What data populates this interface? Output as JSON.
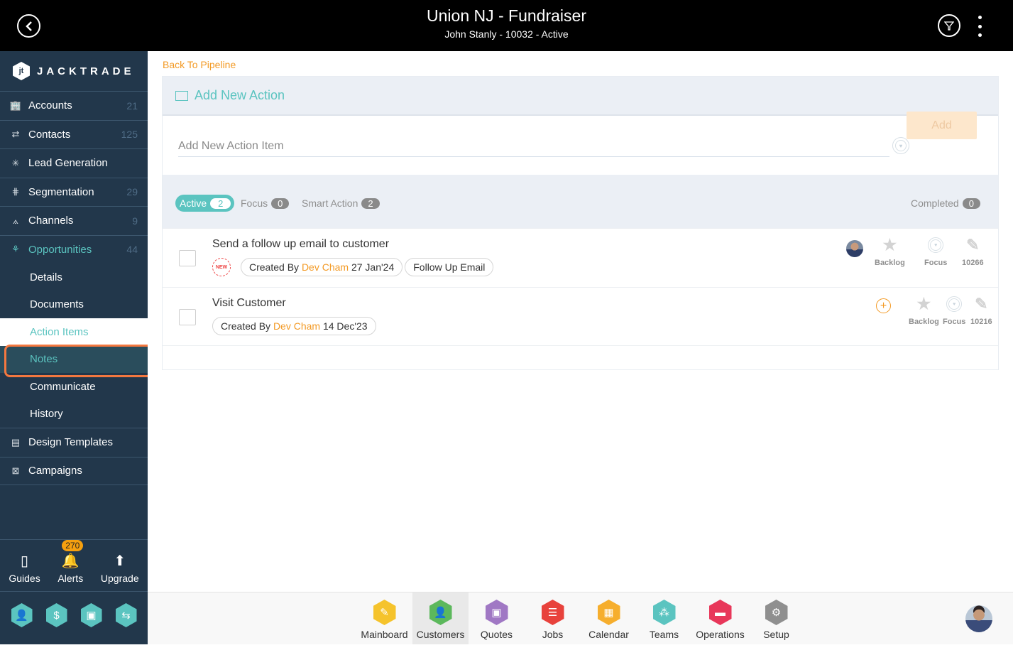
{
  "header": {
    "title": "Union NJ - Fundraiser",
    "subtitle": "John Stanly - 10032 - Active",
    "back_icon": "circle-chevron-left-icon",
    "filter_icon": "filter-icon",
    "menu_icon": "kebab-menu-icon"
  },
  "sidebar": {
    "brand": "JACKTRADE",
    "brand_mark": "jt",
    "items": [
      {
        "label": "Accounts",
        "count": "21",
        "icon": "🏢"
      },
      {
        "label": "Contacts",
        "count": "125",
        "icon": "⇄"
      },
      {
        "label": "Lead Generation",
        "count": "",
        "icon": "✳"
      },
      {
        "label": "Segmentation",
        "count": "29",
        "icon": "⋕"
      },
      {
        "label": "Channels",
        "count": "9",
        "icon": "⟑"
      },
      {
        "label": "Opportunities",
        "count": "44",
        "icon": "⚘"
      }
    ],
    "subitems": [
      {
        "label": "Details"
      },
      {
        "label": "Documents"
      },
      {
        "label": "Action Items"
      },
      {
        "label": "Notes"
      },
      {
        "label": "Communicate"
      },
      {
        "label": "History"
      }
    ],
    "items_after": [
      {
        "label": "Design Templates",
        "icon": "▤"
      },
      {
        "label": "Campaigns",
        "icon": "⊠"
      }
    ],
    "bottom": [
      {
        "label": "Guides",
        "icon": "▯"
      },
      {
        "label": "Alerts",
        "icon": "🔔",
        "badge": "270"
      },
      {
        "label": "Upgrade",
        "icon": "⬆"
      }
    ],
    "quick_icons": [
      "👤",
      "$",
      "▣",
      "⇆"
    ]
  },
  "main": {
    "back_link": "Back To Pipeline",
    "add_panel": {
      "title": "Add New Action",
      "input_placeholder": "Add New Action Item",
      "input_value": "",
      "add_button": "Add"
    },
    "tabs": [
      {
        "label": "Active",
        "count": "2"
      },
      {
        "label": "Focus",
        "count": "0"
      },
      {
        "label": "Smart Action",
        "count": "2"
      }
    ],
    "completed": {
      "label": "Completed",
      "count": "0"
    },
    "rows": [
      {
        "title": "Send a follow up email to customer",
        "new_badge": "NEW",
        "created_prefix": "Created By",
        "creator": "Dev Cham",
        "date": "27 Jan'24",
        "tag": "Follow Up Email",
        "backlog": "Backlog",
        "focus": "Focus",
        "id": "10266"
      },
      {
        "title": "Visit Customer",
        "created_prefix": "Created By",
        "creator": "Dev Cham",
        "date": "14 Dec'23",
        "backlog": "Backlog",
        "focus": "Focus",
        "id": "10216"
      }
    ]
  },
  "dock": {
    "items": [
      {
        "label": "Mainboard",
        "color": "#f5c32c",
        "icon": "✎"
      },
      {
        "label": "Customers",
        "color": "#5cb85c",
        "icon": "👤"
      },
      {
        "label": "Quotes",
        "color": "#a078c4",
        "icon": "▣"
      },
      {
        "label": "Jobs",
        "color": "#e8423c",
        "icon": "☰"
      },
      {
        "label": "Calendar",
        "color": "#f6ae2d",
        "icon": "▦"
      },
      {
        "label": "Teams",
        "color": "#5bc4c0",
        "icon": "⁂"
      },
      {
        "label": "Operations",
        "color": "#e8375a",
        "icon": "▬"
      },
      {
        "label": "Setup",
        "color": "#8f8f8f",
        "icon": "⚙"
      }
    ],
    "selected": "Customers"
  },
  "colors": {
    "accent": "#5bc4c0",
    "orange": "#f39a25",
    "sidebar_bg": "#22374b",
    "highlight_border": "#f4783f"
  }
}
